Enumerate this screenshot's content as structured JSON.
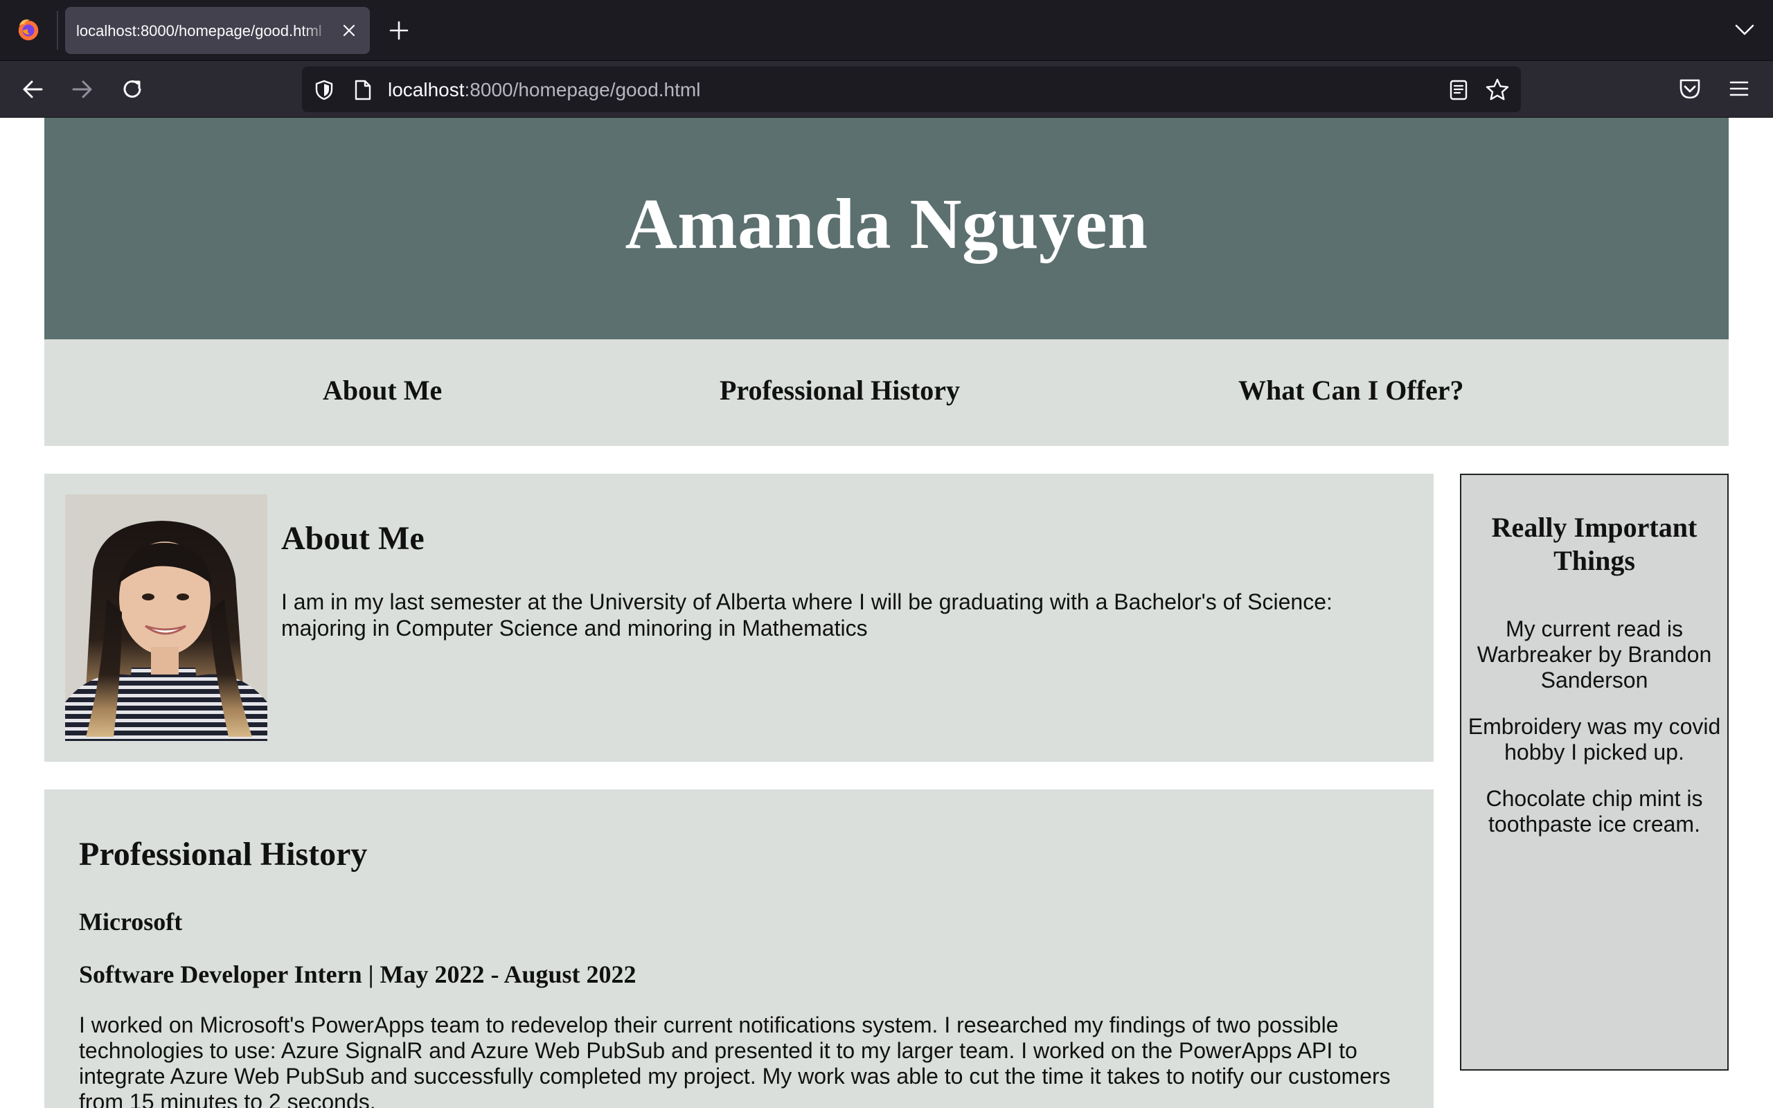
{
  "browser": {
    "tab_title": "localhost:8000/homepage/good.html",
    "url_host": "localhost",
    "url_rest": ":8000/homepage/good.html"
  },
  "page": {
    "name": "Amanda Nguyen",
    "nav": [
      "About Me",
      "Professional History",
      "What Can I Offer?"
    ],
    "about": {
      "heading": "About Me",
      "text": "I am in my last semester at the University of Alberta where I will be graduating with a Bachelor's of Science: majoring in Computer Science and minoring in Mathematics"
    },
    "history": {
      "heading": "Professional History",
      "company": "Microsoft",
      "role": "Software Developer Intern | May 2022 - August 2022",
      "text": "I worked on Microsoft's PowerApps team to redevelop their current notifications system. I researched my findings of two possible technologies to use: Azure SignalR and Azure Web PubSub and presented it to my larger team. I worked on the PowerApps API to integrate Azure Web PubSub and successfully completed my project. My work was able to cut the time it takes to notify our customers from 15 minutes to 2 seconds."
    },
    "sidebar": {
      "heading": "Really Important Things",
      "facts": [
        "My current read is Warbreaker by Brandon Sanderson",
        "Embroidery was my covid hobby I picked up.",
        "Chocolate chip mint is toothpaste ice cream."
      ]
    }
  },
  "colors": {
    "hero_bg": "#5b706f",
    "panel_bg": "#dadfdb",
    "sidebar_bg": "#d4d5d5"
  },
  "icons": [
    "firefox-icon",
    "close-icon",
    "plus-icon",
    "chevron-down-icon",
    "back-arrow-icon",
    "forward-arrow-icon",
    "reload-icon",
    "shield-icon",
    "page-icon",
    "reader-view-icon",
    "star-icon",
    "pocket-icon",
    "hamburger-menu-icon"
  ]
}
